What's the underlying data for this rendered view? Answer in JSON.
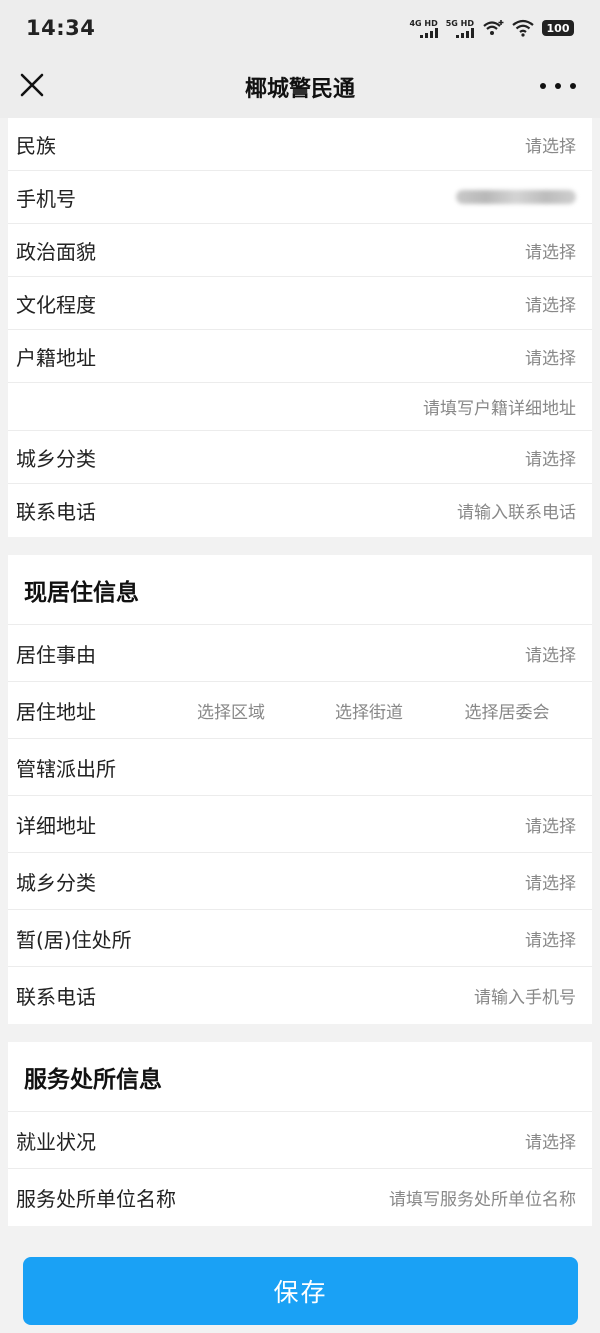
{
  "status_bar": {
    "time": "14:34",
    "network1": "4G HD",
    "network2": "5G HD",
    "battery": "100"
  },
  "nav": {
    "title": "椰城警民通"
  },
  "household": {
    "rows": [
      {
        "label": "民族",
        "value": "请选择"
      },
      {
        "label": "手机号",
        "value": ""
      },
      {
        "label": "政治面貌",
        "value": "请选择"
      },
      {
        "label": "文化程度",
        "value": "请选择"
      },
      {
        "label": "户籍地址",
        "value": "请选择"
      },
      {
        "label": "",
        "value": "请填写户籍详细地址"
      },
      {
        "label": "城乡分类",
        "value": "请选择"
      },
      {
        "label": "联系电话",
        "value": "请输入联系电话"
      }
    ]
  },
  "residence": {
    "title": "现居住信息",
    "reason": {
      "label": "居住事由",
      "value": "请选择"
    },
    "address": {
      "label": "居住地址",
      "options": [
        "选择区域",
        "选择街道",
        "选择居委会"
      ]
    },
    "police_station": {
      "label": "管辖派出所",
      "value": ""
    },
    "detail_address": {
      "label": "详细地址",
      "value": "请选择"
    },
    "urban_rural": {
      "label": "城乡分类",
      "value": "请选择"
    },
    "temp_residence": {
      "label": "暂(居)住处所",
      "value": "请选择"
    },
    "phone": {
      "label": "联系电话",
      "value": "请输入手机号"
    }
  },
  "service": {
    "title": "服务处所信息",
    "employment": {
      "label": "就业状况",
      "value": "请选择"
    },
    "company": {
      "label": "服务处所单位名称",
      "value": "请填写服务处所单位名称"
    }
  },
  "footer": {
    "save_label": "保存",
    "accent_color": "#1aa1f5"
  }
}
